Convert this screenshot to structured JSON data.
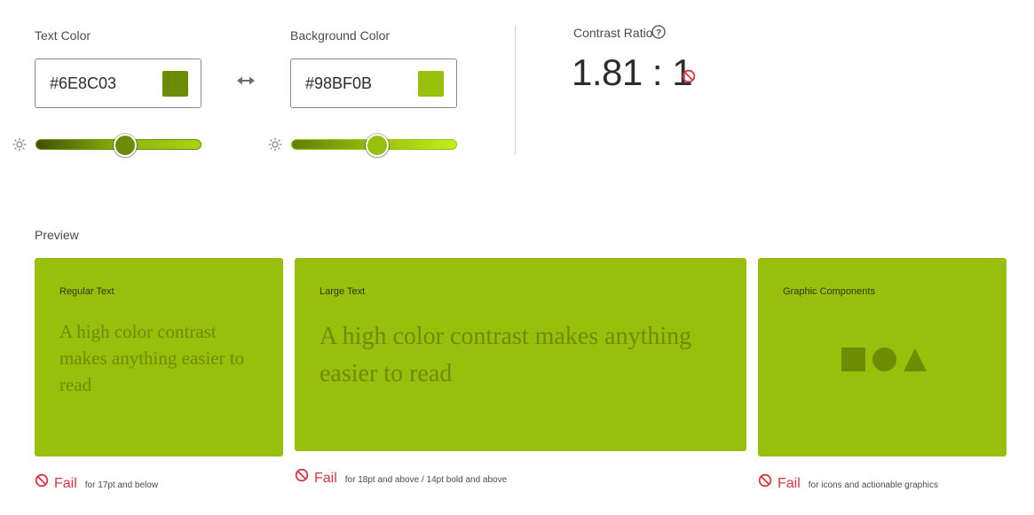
{
  "colors": {
    "text": "#6E8C03",
    "background": "#98BF0B",
    "fail": "#d7373f"
  },
  "text_color": {
    "label": "Text Color",
    "value": "#6E8C03",
    "lightness_percent": 54
  },
  "swap": {
    "icon": "swap-arrows-icon"
  },
  "background_color": {
    "label": "Background Color",
    "value": "#98BF0B",
    "lightness_percent": 52
  },
  "contrast": {
    "label": "Contrast Ratio",
    "value": "1.81 : 1",
    "help_icon": "help-icon",
    "status_icon": "no-entry-icon"
  },
  "preview": {
    "label": "Preview",
    "cards": [
      {
        "title": "Regular Text",
        "sample": "A high color contrast makes anything easier to read",
        "result": "Fail",
        "note": "for 17pt and below"
      },
      {
        "title": "Large Text",
        "sample": "A high color contrast makes anything easier to read",
        "result": "Fail",
        "note": "for 18pt and above / 14pt bold and above"
      },
      {
        "title": "Graphic Components",
        "shapes": [
          "square-shape",
          "circle-shape",
          "triangle-shape"
        ],
        "result": "Fail",
        "note": "for icons and actionable graphics"
      }
    ]
  }
}
